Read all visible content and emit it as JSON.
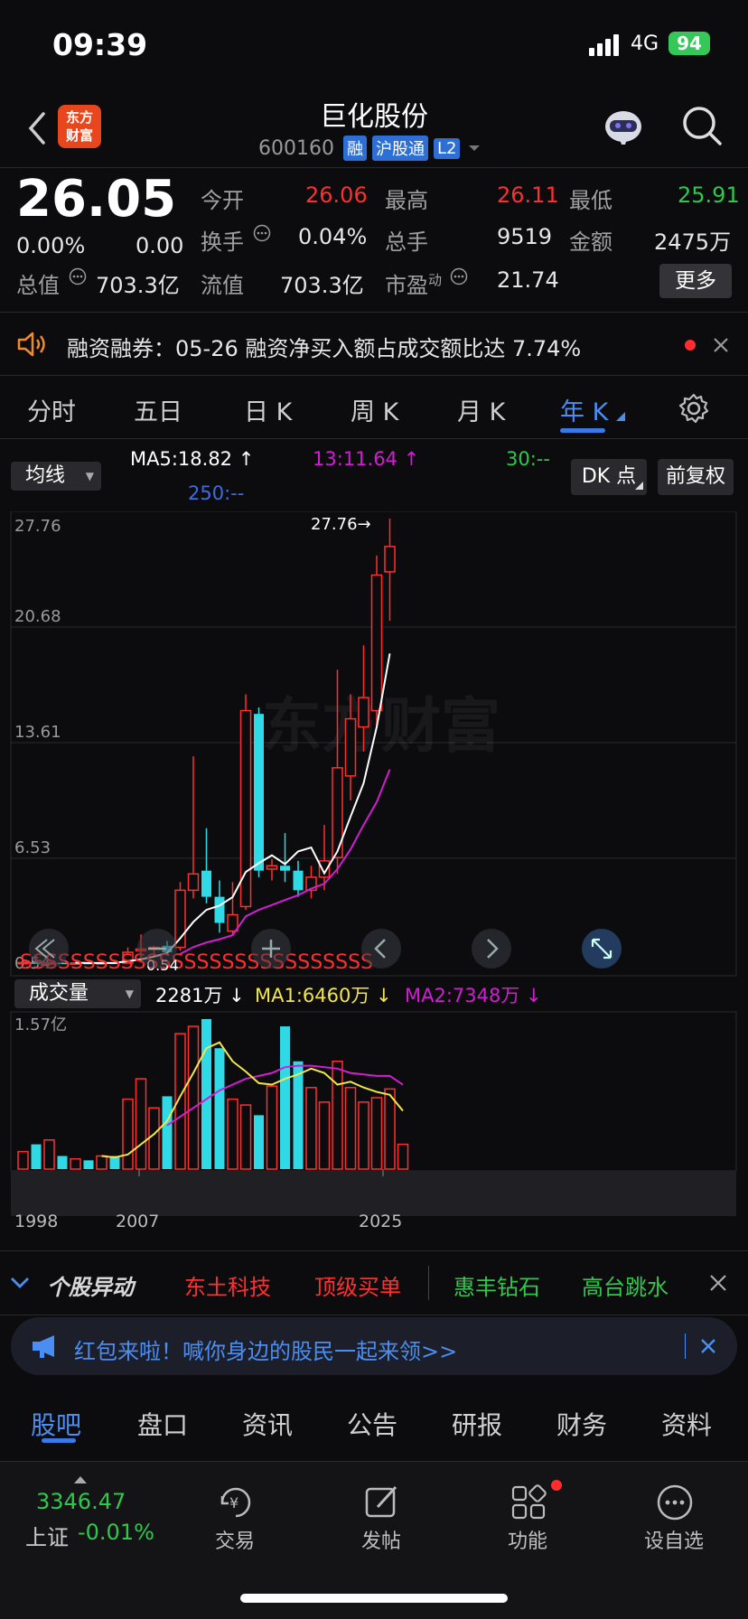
{
  "status": {
    "time": "09:39",
    "network": "4G",
    "battery": "94"
  },
  "nav": {
    "logo_line1": "东方",
    "logo_line2": "财富",
    "title": "巨化股份",
    "code": "600160",
    "tags": [
      "融",
      "沪股通",
      "L2"
    ]
  },
  "quote": {
    "price": "26.05",
    "change_pct": "0.00%",
    "change": "0.00",
    "open_label": "今开",
    "open": "26.06",
    "high_label": "最高",
    "high": "26.11",
    "low_label": "最低",
    "low": "25.91",
    "turnover_label": "换手",
    "turnover": "0.04%",
    "volume_label": "总手",
    "volume": "9519",
    "amount_label": "金额",
    "amount": "2475万",
    "mktcap_label": "总值",
    "mktcap": "703.3亿",
    "float_label": "流值",
    "float": "703.3亿",
    "pe_label": "市盈",
    "pe_sup": "动",
    "pe": "21.74",
    "more_label": "更多"
  },
  "notice": {
    "text": "融资融券：05-26 融资净买入额占成交额比达 7.74%"
  },
  "tabs": [
    "分时",
    "五日",
    "日 K",
    "周 K",
    "月 K",
    "年 K"
  ],
  "active_tab": "年 K",
  "indicators": {
    "dropdown": "均线",
    "ma5": "MA5:18.82 ↑",
    "ma13": "13:11.64 ↑",
    "ma30": "30:--",
    "ma250": "250:--",
    "dk_label": "DK 点",
    "adj_label": "前复权",
    "max_marker": "27.76→",
    "y_ticks": [
      "27.76",
      "20.68",
      "13.61",
      "6.53",
      "0.54"
    ],
    "watermark": "东方财富",
    "overlay_text": "SSSSSSSSSSSSSSSSSSSSSSSSSSSS",
    "low_marker": "0.54",
    "vol_dropdown": "成交量",
    "vol_value": "2281万 ↓",
    "vol_ma1": "MA1:6460万 ↓",
    "vol_ma2": "MA2:7348万 ↓",
    "vol_max": "1.57亿",
    "x_labels": [
      "1998",
      "2007",
      "2025"
    ]
  },
  "colors": {
    "up": "#ff2f2f",
    "down": "#2fd9e6",
    "ma5": "#ffffff",
    "ma13": "#d21ed2",
    "ma30": "#2ec94a",
    "ma250": "#3f6de0",
    "vol_ma1": "#f2e64a",
    "vol_ma2": "#d21ed2"
  },
  "chart_data": {
    "type": "candlestick",
    "title": "",
    "y_range": [
      0.54,
      27.76
    ],
    "candles": [
      {
        "o": 0.54,
        "h": 0.6,
        "l": 0.5,
        "c": 0.58
      },
      {
        "o": 0.58,
        "h": 0.62,
        "l": 0.52,
        "c": 0.55
      },
      {
        "o": 0.55,
        "h": 0.6,
        "l": 0.5,
        "c": 0.56
      },
      {
        "o": 0.56,
        "h": 0.6,
        "l": 0.52,
        "c": 0.54
      },
      {
        "o": 0.54,
        "h": 0.58,
        "l": 0.5,
        "c": 0.55
      },
      {
        "o": 0.55,
        "h": 0.6,
        "l": 0.52,
        "c": 0.54
      },
      {
        "o": 0.54,
        "h": 0.58,
        "l": 0.5,
        "c": 0.56
      },
      {
        "o": 0.56,
        "h": 0.6,
        "l": 0.52,
        "c": 0.54
      },
      {
        "o": 0.54,
        "h": 1.5,
        "l": 0.54,
        "c": 1.2
      },
      {
        "o": 1.3,
        "h": 2.3,
        "l": 0.8,
        "c": 1.4
      },
      {
        "o": 1.4,
        "h": 1.6,
        "l": 0.9,
        "c": 1.5
      },
      {
        "o": 1.6,
        "h": 1.9,
        "l": 1.0,
        "c": 1.2
      },
      {
        "o": 1.5,
        "h": 5.5,
        "l": 1.3,
        "c": 5.0
      },
      {
        "o": 5.0,
        "h": 13.2,
        "l": 4.5,
        "c": 6.0
      },
      {
        "o": 6.2,
        "h": 8.8,
        "l": 4.2,
        "c": 4.6
      },
      {
        "o": 4.6,
        "h": 5.6,
        "l": 2.4,
        "c": 3.0
      },
      {
        "o": 2.5,
        "h": 5.5,
        "l": 2.2,
        "c": 3.5
      },
      {
        "o": 4.0,
        "h": 17.0,
        "l": 3.8,
        "c": 16.0
      },
      {
        "o": 15.8,
        "h": 16.2,
        "l": 5.8,
        "c": 6.2
      },
      {
        "o": 6.3,
        "h": 6.9,
        "l": 5.6,
        "c": 6.5
      },
      {
        "o": 6.5,
        "h": 8.5,
        "l": 5.5,
        "c": 6.2
      },
      {
        "o": 6.2,
        "h": 6.8,
        "l": 4.6,
        "c": 5.0
      },
      {
        "o": 5.0,
        "h": 6.5,
        "l": 4.5,
        "c": 5.8
      },
      {
        "o": 5.8,
        "h": 9.0,
        "l": 5.0,
        "c": 6.8
      },
      {
        "o": 7.0,
        "h": 18.5,
        "l": 6.0,
        "c": 12.5
      },
      {
        "o": 12.0,
        "h": 17.0,
        "l": 10.5,
        "c": 15.5
      },
      {
        "o": 15.0,
        "h": 20.0,
        "l": 13.5,
        "c": 16.8
      },
      {
        "o": 16.0,
        "h": 25.5,
        "l": 15.0,
        "c": 24.3
      },
      {
        "o": 24.5,
        "h": 27.76,
        "l": 21.5,
        "c": 26.05
      }
    ],
    "ma5": [
      null,
      null,
      null,
      null,
      0.56,
      0.55,
      0.55,
      0.55,
      0.66,
      0.77,
      0.94,
      1.15,
      2.06,
      3.06,
      3.8,
      4.06,
      4.58,
      6.12,
      6.66,
      7.14,
      6.6,
      7.38,
      7.62,
      6.04,
      7.38,
      9.5,
      11.56,
      15.0,
      19.5
    ],
    "ma13": [
      null,
      null,
      null,
      null,
      null,
      null,
      null,
      null,
      null,
      null,
      null,
      null,
      1.1,
      1.52,
      1.8,
      2.0,
      2.25,
      3.4,
      3.8,
      4.1,
      4.4,
      4.7,
      5.1,
      5.4,
      6.3,
      7.5,
      9.0,
      10.4,
      12.4
    ],
    "volume": [
      12,
      17,
      20,
      9,
      7,
      6,
      9,
      9,
      48,
      62,
      42,
      50,
      93,
      98,
      103,
      83,
      48,
      44,
      37,
      57,
      98,
      74,
      56,
      46,
      74,
      56,
      46,
      49,
      55,
      17
    ],
    "vol_ma1": [
      null,
      null,
      null,
      null,
      null,
      null,
      9,
      8,
      10,
      17,
      24,
      33,
      50,
      66,
      83,
      87,
      74,
      67,
      59,
      58,
      62,
      65,
      69,
      66,
      58,
      60,
      56,
      53,
      51,
      40
    ],
    "vol_ma2": [
      null,
      null,
      null,
      null,
      null,
      null,
      null,
      null,
      null,
      null,
      null,
      30,
      36,
      42,
      48,
      54,
      58,
      62,
      64,
      66,
      70,
      71,
      71,
      70,
      69,
      66,
      65,
      64,
      64,
      58
    ],
    "x_labels": [
      "1998",
      "2007",
      "2025"
    ]
  },
  "promo_bar": {
    "title": "个股异动",
    "items": [
      "东土科技",
      "顶级买单",
      "惠丰钻石",
      "高台跳水"
    ]
  },
  "ad": {
    "text": "红包来啦！喊你身边的股民一起来领>>"
  },
  "bottom_tabs": [
    "股吧",
    "盘口",
    "资讯",
    "公告",
    "研报",
    "财务",
    "资料"
  ],
  "dock": {
    "index_value": "3346.47",
    "index_name": "上证",
    "index_change": "-0.01%",
    "items": [
      "交易",
      "发帖",
      "功能",
      "设自选"
    ]
  }
}
